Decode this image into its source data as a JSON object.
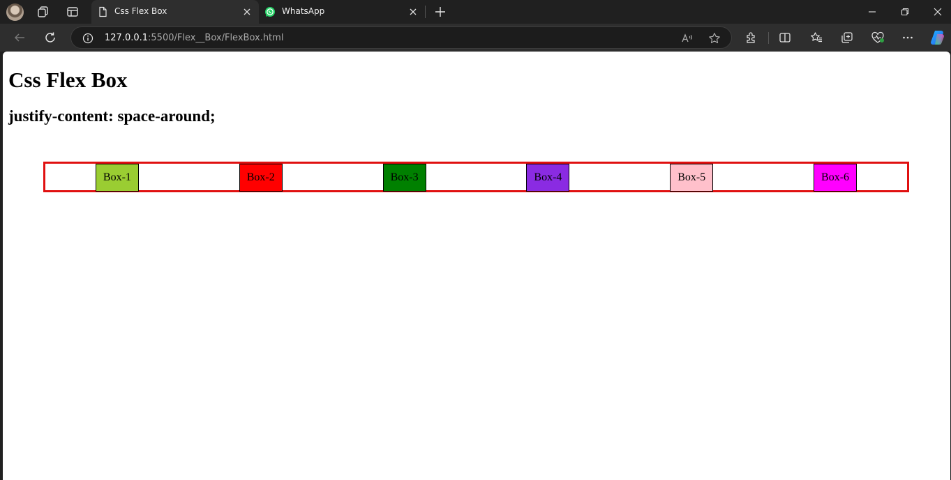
{
  "browser": {
    "tabs": [
      {
        "title": "Css Flex Box",
        "favicon": "page-icon",
        "active": true
      },
      {
        "title": "WhatsApp",
        "favicon": "whatsapp-icon",
        "active": false
      }
    ],
    "address": {
      "host": "127.0.0.1",
      "path": ":5500/Flex__Box/FlexBox.html"
    }
  },
  "page": {
    "heading": "Css Flex Box",
    "subheading": "justify-content: space-around;",
    "container_border_color": "#e01010",
    "boxes": [
      {
        "label": "Box-1",
        "color": "#9acd32"
      },
      {
        "label": "Box-2",
        "color": "#ff0000"
      },
      {
        "label": "Box-3",
        "color": "#008000"
      },
      {
        "label": "Box-4",
        "color": "#8a2be2"
      },
      {
        "label": "Box-5",
        "color": "#ffc0cb"
      },
      {
        "label": "Box-6",
        "color": "#ff00ff"
      }
    ]
  }
}
